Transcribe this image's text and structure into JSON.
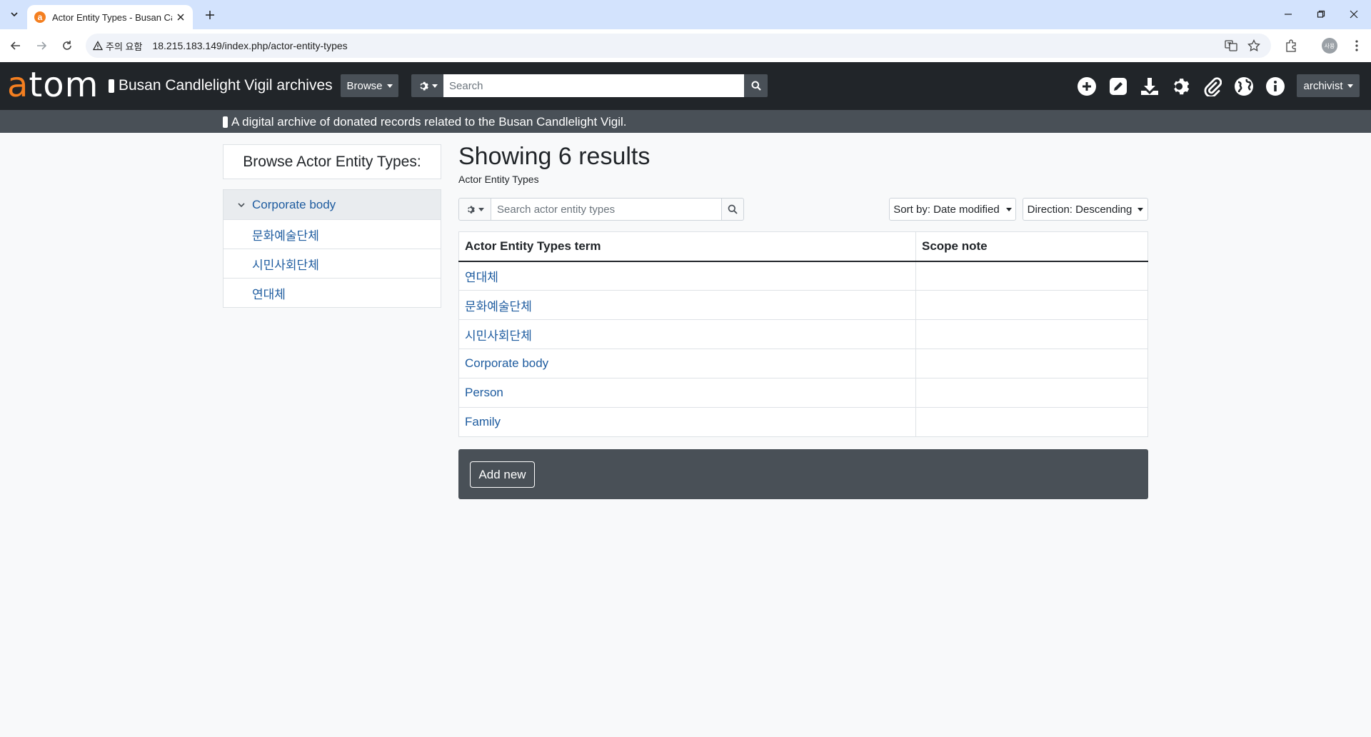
{
  "browser": {
    "tab_title": "Actor Entity Types - Busan Candlelight Vigil archives",
    "tab_favicon_letter": "a",
    "omnibox_warning": "주의 요함",
    "url": "18.215.183.149/index.php/actor-entity-types",
    "profile_initials": "사용"
  },
  "header": {
    "logo_accent": "a",
    "logo_rest": "tom",
    "site_name": "Busan Candlelight Vigil archives",
    "browse_label": "Browse",
    "search_placeholder": "Search",
    "user_label": "archivist",
    "site_description": "A digital archive of donated records related to the Busan Candlelight Vigil."
  },
  "sidebar": {
    "heading": "Browse Actor Entity Types:",
    "root": "Corporate body",
    "children": [
      "문화예술단체",
      "시민사회단체",
      "연대체"
    ]
  },
  "main": {
    "title": "Showing 6 results",
    "subtitle": "Actor Entity Types",
    "filter_placeholder": "Search actor entity types",
    "sort_label": "Sort by: Date modified",
    "direction_label": "Direction: Descending",
    "table": {
      "headers": [
        "Actor Entity Types term",
        "Scope note"
      ],
      "rows": [
        [
          "연대체",
          ""
        ],
        [
          "문화예술단체",
          ""
        ],
        [
          "시민사회단체",
          ""
        ],
        [
          "Corporate body",
          ""
        ],
        [
          "Person",
          ""
        ],
        [
          "Family",
          ""
        ]
      ]
    },
    "add_new_label": "Add new"
  },
  "colors": {
    "brand_orange": "#f47f20",
    "header_dark": "#212529",
    "header_gray": "#495057",
    "link_blue": "#1d5b9f"
  }
}
